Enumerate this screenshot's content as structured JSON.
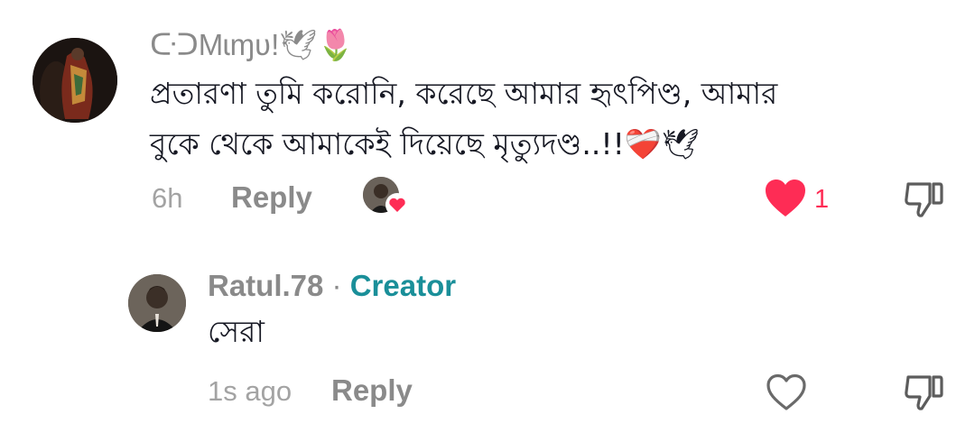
{
  "comment": {
    "username": "ᑢᑐMɩɱʋ!",
    "username_emojis": "🕊🌷",
    "text_line1": "প্রতারণা তুমি করোনি, করেছে আমার হৃৎপিণ্ড, আমার",
    "text_line2": "বুকে থেকে আমাকেই দিয়েছে মৃত্যুদণ্ড..!!",
    "text_emojis": "❤‍🩹🕊",
    "time": "6h",
    "reply_label": "Reply",
    "like_count": "1",
    "creator_liked": true
  },
  "reply": {
    "username": "Ratul.78",
    "separator": " · ",
    "badge": "Creator",
    "text": "সেরা",
    "time": "1s ago",
    "reply_label": "Reply"
  },
  "colors": {
    "like_active": "#fe2c55",
    "creator_badge": "#1a8f99",
    "secondary_text": "#8a8a8a"
  }
}
